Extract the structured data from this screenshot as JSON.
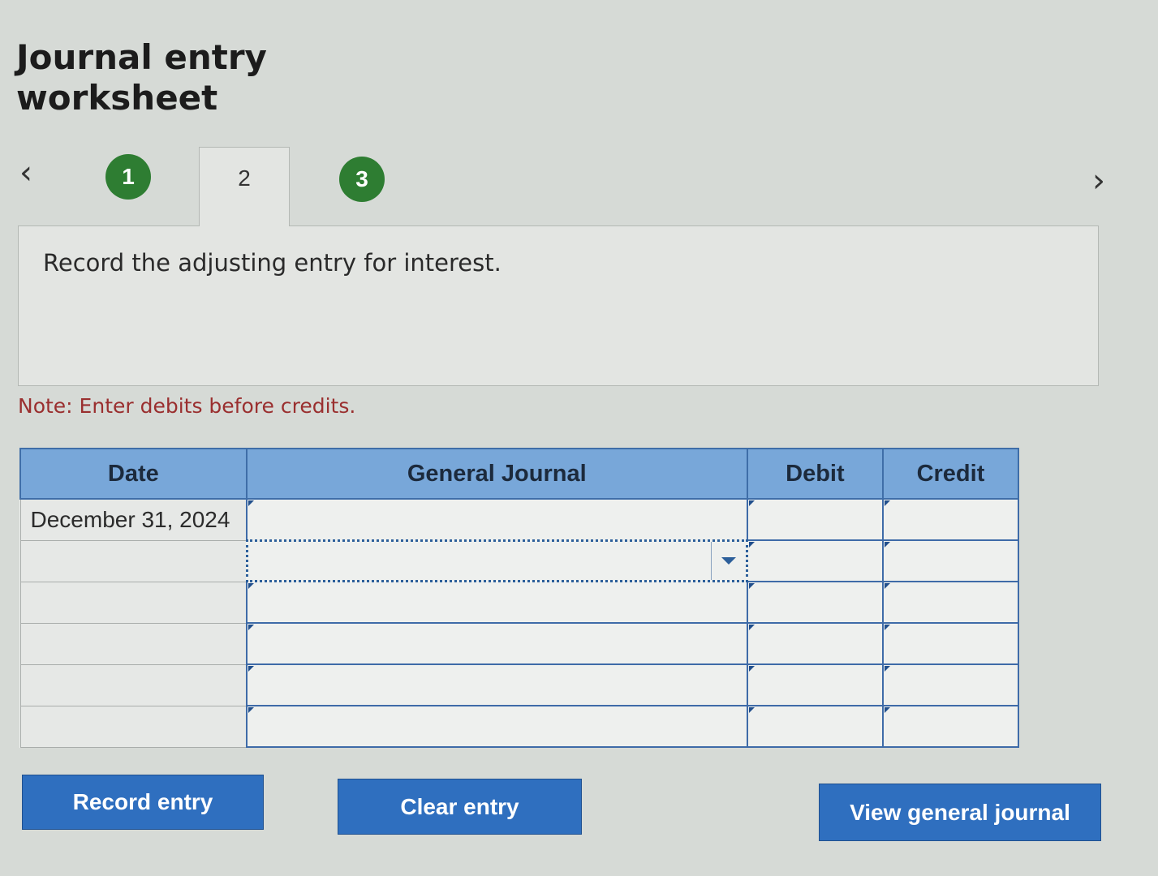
{
  "page": {
    "title": "Journal entry worksheet"
  },
  "steps": {
    "prev_icon": "chevron-left-icon",
    "next_icon": "chevron-right-icon",
    "items": [
      {
        "label": "1",
        "status": "complete",
        "color": "#2e7d32"
      },
      {
        "label": "2",
        "status": "current"
      },
      {
        "label": "3",
        "status": "complete",
        "color": "#2e7d32"
      }
    ]
  },
  "instruction": {
    "text": "Record the adjusting entry for interest."
  },
  "note": {
    "text": "Note: Enter debits before credits."
  },
  "journal_table": {
    "columns": [
      "Date",
      "General Journal",
      "Debit",
      "Credit"
    ],
    "rows": [
      {
        "date": "December 31, 2024",
        "account": "",
        "debit": "",
        "credit": ""
      },
      {
        "date": "",
        "account": "",
        "debit": "",
        "credit": "",
        "account_dropdown": true
      },
      {
        "date": "",
        "account": "",
        "debit": "",
        "credit": ""
      },
      {
        "date": "",
        "account": "",
        "debit": "",
        "credit": ""
      },
      {
        "date": "",
        "account": "",
        "debit": "",
        "credit": ""
      },
      {
        "date": "",
        "account": "",
        "debit": "",
        "credit": ""
      }
    ],
    "header_color": "#78a7d9",
    "border_color": "#3e6ba8"
  },
  "buttons": {
    "record": "Record entry",
    "clear": "Clear entry",
    "view": "View general journal",
    "color": "#2f6fbf"
  }
}
